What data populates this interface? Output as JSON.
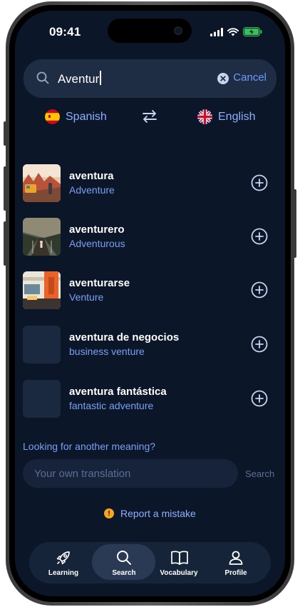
{
  "status_bar": {
    "time": "09:41"
  },
  "search": {
    "value": "Aventur",
    "cancel_label": "Cancel"
  },
  "languages": {
    "from": "Spanish",
    "to": "English"
  },
  "results": [
    {
      "word": "aventura",
      "translation": "Adventure"
    },
    {
      "word": "aventurero",
      "translation": "Adventurous"
    },
    {
      "word": "aventurarse",
      "translation": "Venture"
    },
    {
      "word": "aventura de negocios",
      "translation": "business venture"
    },
    {
      "word": "aventura fantástica",
      "translation": "fantastic adventure"
    }
  ],
  "another_meaning": {
    "prompt": "Looking for another meaning?",
    "placeholder": "Your own translation",
    "search_label": "Search"
  },
  "report_label": "Report a mistake",
  "tabs": [
    {
      "label": "Learning",
      "icon": "rocket-icon"
    },
    {
      "label": "Search",
      "icon": "search-icon"
    },
    {
      "label": "Vocabulary",
      "icon": "book-icon"
    },
    {
      "label": "Profile",
      "icon": "user-icon"
    }
  ],
  "colors": {
    "background": "#0b1628",
    "accent": "#6b9bff",
    "warning": "#f5a524"
  }
}
